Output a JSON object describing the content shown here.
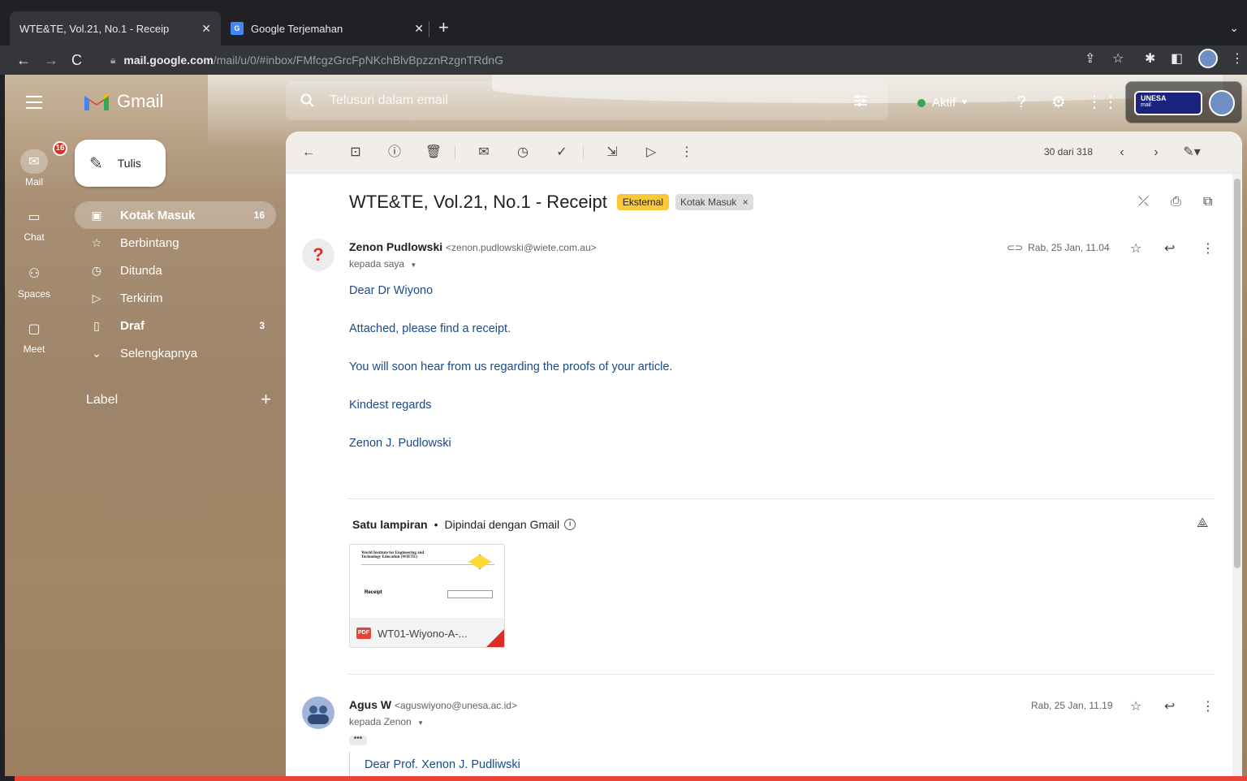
{
  "browser": {
    "tabs": [
      {
        "title": "WTE&TE, Vol.21, No.1 - Receip",
        "active": true,
        "favicon": "gmail-favicon"
      },
      {
        "title": "Google Terjemahan",
        "active": false,
        "favicon": "translate-favicon"
      }
    ],
    "url_host": "mail.google.com",
    "url_path": "/mail/u/0/#inbox/FMfcgzGrcFpNKchBlvBpzznRzgnTRdnG"
  },
  "gmail": {
    "logo_text": "Gmail",
    "search_placeholder": "Telusuri dalam email",
    "status": "Aktif",
    "account_logo_text": "UNESA",
    "account_logo_sub": "mail",
    "rail": [
      {
        "label": "Mail",
        "badge": "16"
      },
      {
        "label": "Chat"
      },
      {
        "label": "Spaces"
      },
      {
        "label": "Meet"
      }
    ],
    "compose_label": "Tulis",
    "nav": [
      {
        "label": "Kotak Masuk",
        "count": "16",
        "icon": "inbox-icon"
      },
      {
        "label": "Berbintang",
        "count": "",
        "icon": "star-icon"
      },
      {
        "label": "Ditunda",
        "count": "",
        "icon": "clock-icon"
      },
      {
        "label": "Terkirim",
        "count": "",
        "icon": "send-icon"
      },
      {
        "label": "Draf",
        "count": "3",
        "icon": "draft-icon"
      },
      {
        "label": "Selengkapnya",
        "count": "",
        "icon": "chevron-down-icon"
      }
    ],
    "label_heading": "Label"
  },
  "toolbar": {
    "pager": "30 dari 318"
  },
  "thread": {
    "subject": "WTE&TE, Vol.21, No.1 - Receipt",
    "tag_external": "Eksternal",
    "tag_inbox": "Kotak Masuk",
    "message1": {
      "sender_name": "Zenon Pudlowski",
      "sender_email": "<zenon.pudlowski@wiete.com.au>",
      "to": "kepada saya",
      "date": "Rab, 25 Jan, 11.04",
      "body": [
        "Dear Dr Wiyono",
        "Attached, please find a receipt.",
        "You will soon hear from us regarding the proofs of your article.",
        "Kindest regards",
        "Zenon J. Pudlowski"
      ],
      "attachment_heading": "Satu lampiran",
      "attachment_scan": "Dipindai dengan Gmail",
      "attachment_name": "WT01-Wiyono-A-...",
      "attachment_type": "PDF",
      "attachment_preview_title": "World Institute for Engineering and Technology Education (WIETE)",
      "attachment_preview_receipt": "Receipt"
    },
    "message2": {
      "sender_name": "Agus W",
      "sender_email": "<aguswiyono@unesa.ac.id>",
      "to": "kepada Zenon",
      "date": "Rab, 25 Jan, 11.19",
      "quote": "Dear Prof. Xenon J. Pudliwski"
    }
  }
}
